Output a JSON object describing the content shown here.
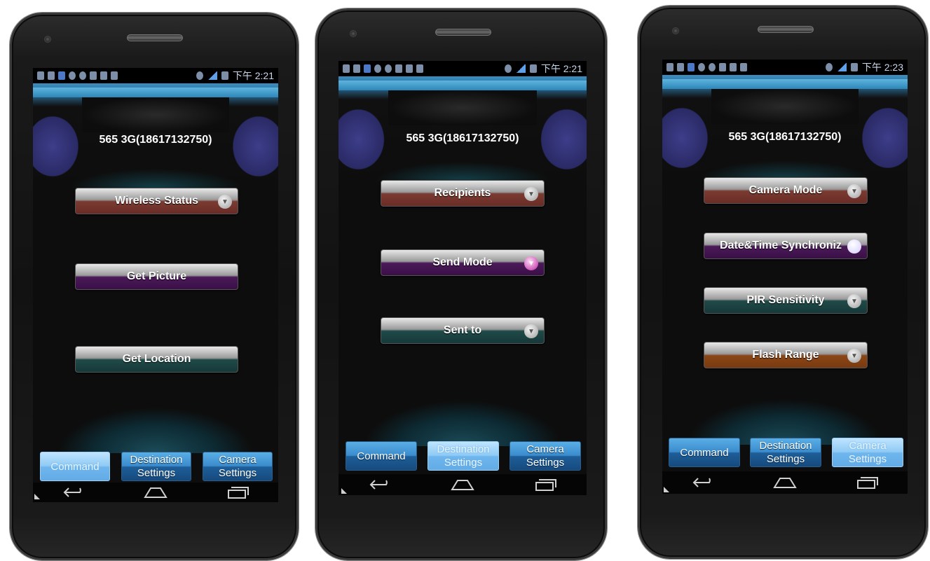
{
  "phones": [
    {
      "status": {
        "time": "下午 2:21"
      },
      "device_title": "565 3G(18617132750)",
      "buttons": [
        {
          "label": "Wireless Status",
          "has_dropdown": true
        },
        {
          "label": "Get Picture",
          "has_dropdown": false
        },
        {
          "label": "Get Location",
          "has_dropdown": false
        }
      ],
      "tabs": [
        {
          "line1": "Command",
          "line2": "",
          "active": true
        },
        {
          "line1": "Destination",
          "line2": "Settings",
          "active": false
        },
        {
          "line1": "Camera",
          "line2": "Settings",
          "active": false
        }
      ]
    },
    {
      "status": {
        "time": "下午 2:21"
      },
      "device_title": "565 3G(18617132750)",
      "buttons": [
        {
          "label": "Recipients",
          "has_dropdown": true
        },
        {
          "label": "Send Mode",
          "has_dropdown": true
        },
        {
          "label": "Sent to",
          "has_dropdown": true
        }
      ],
      "tabs": [
        {
          "line1": "Command",
          "line2": "",
          "active": false
        },
        {
          "line1": "Destination",
          "line2": "Settings",
          "active": true
        },
        {
          "line1": "Camera",
          "line2": "Settings",
          "active": false
        }
      ]
    },
    {
      "status": {
        "time": "下午 2:23"
      },
      "device_title": "565 3G(18617132750)",
      "buttons": [
        {
          "label": "Camera Mode",
          "has_dropdown": true
        },
        {
          "label": "Date&Time Synchroniz",
          "has_dropdown": true
        },
        {
          "label": "PIR Sensitivity",
          "has_dropdown": true
        },
        {
          "label": "Flash Range",
          "has_dropdown": true
        }
      ],
      "tabs": [
        {
          "line1": "Command",
          "line2": "",
          "active": false
        },
        {
          "line1": "Destination",
          "line2": "Settings",
          "active": false
        },
        {
          "line1": "Camera",
          "line2": "Settings",
          "active": true
        }
      ]
    }
  ],
  "nav_icons": [
    "back-icon",
    "home-icon",
    "recent-apps-icon"
  ],
  "colors": {
    "tab_blue": "#3a8ccc",
    "tab_active": "#8fcaf4",
    "button_red": "#7a3b32",
    "button_purple": "#4a1a58",
    "button_teal": "#1f4a48",
    "button_orange": "#8a4616"
  }
}
